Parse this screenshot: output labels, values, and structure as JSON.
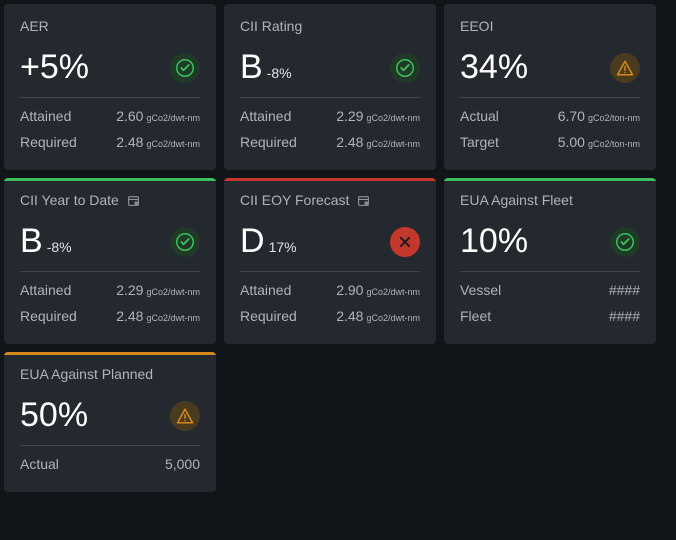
{
  "cards": [
    {
      "title": "AER",
      "bar": "",
      "value": "+5%",
      "subvalue": "",
      "status": "check",
      "rows": [
        {
          "label": "Attained",
          "value": "2.60",
          "unit": "gCo2/dwt-nm"
        },
        {
          "label": "Required",
          "value": "2.48",
          "unit": "gCo2/dwt-nm"
        }
      ]
    },
    {
      "title": "CII Rating",
      "bar": "",
      "value": "B",
      "subvalue": "-8%",
      "status": "check",
      "rows": [
        {
          "label": "Attained",
          "value": "2.29",
          "unit": "gCo2/dwt-nm"
        },
        {
          "label": "Required",
          "value": "2.48",
          "unit": "gCo2/dwt-nm"
        }
      ]
    },
    {
      "title": "EEOI",
      "bar": "",
      "value": "34%",
      "subvalue": "",
      "status": "warn",
      "rows": [
        {
          "label": "Actual",
          "value": "6.70",
          "unit": "gCo2/ton-nm"
        },
        {
          "label": "Target",
          "value": "5.00",
          "unit": "gCo2/ton-nm"
        }
      ]
    },
    {
      "title": "CII Year to Date",
      "bar": "green",
      "calendar": true,
      "value": "B",
      "subvalue": "-8%",
      "status": "check",
      "rows": [
        {
          "label": "Attained",
          "value": "2.29",
          "unit": "gCo2/dwt-nm"
        },
        {
          "label": "Required",
          "value": "2.48",
          "unit": "gCo2/dwt-nm"
        }
      ]
    },
    {
      "title": "CII EOY Forecast",
      "bar": "red",
      "calendar": true,
      "value": "D",
      "subvalue": "17%",
      "status": "error",
      "rows": [
        {
          "label": "Attained",
          "value": "2.90",
          "unit": "gCo2/dwt-nm"
        },
        {
          "label": "Required",
          "value": "2.48",
          "unit": "gCo2/dwt-nm"
        }
      ]
    },
    {
      "title": "EUA Against Fleet",
      "bar": "green",
      "value": "10%",
      "subvalue": "",
      "status": "check",
      "rows": [
        {
          "label": "Vessel",
          "value": "####",
          "unit": ""
        },
        {
          "label": "Fleet",
          "value": "####",
          "unit": ""
        }
      ]
    },
    {
      "title": "EUA Against Planned",
      "bar": "orange",
      "value": "50%",
      "subvalue": "",
      "status": "warn",
      "rows": [
        {
          "label": "Actual",
          "value": "5,000",
          "unit": ""
        }
      ]
    }
  ]
}
